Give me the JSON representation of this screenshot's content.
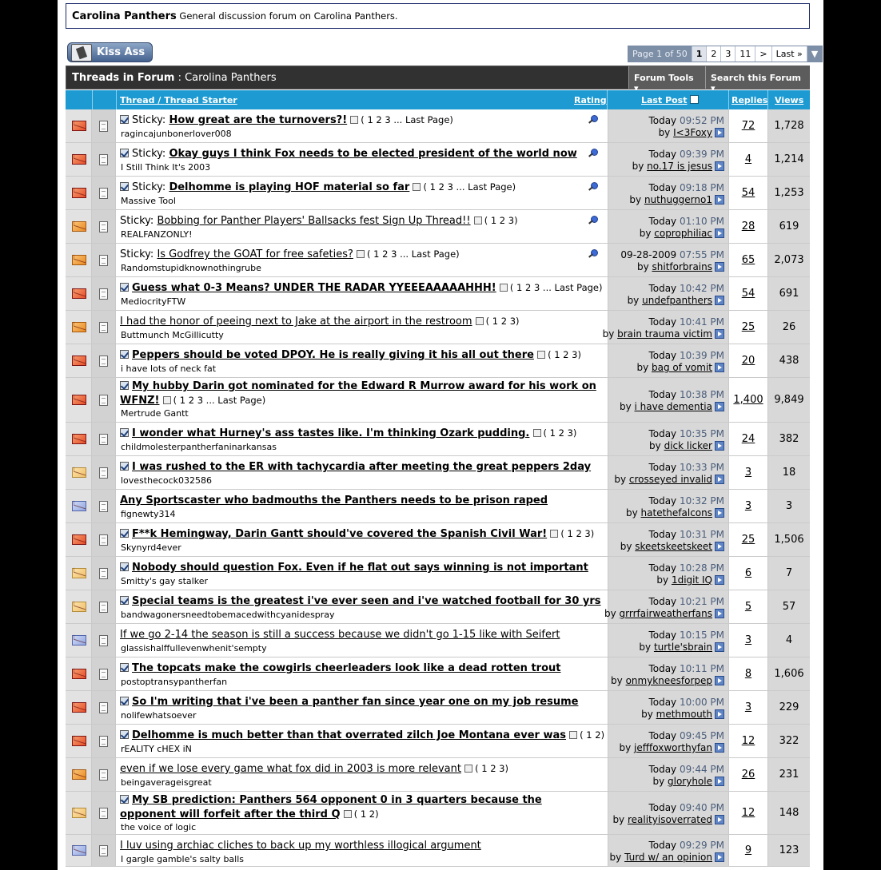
{
  "forum_header": {
    "name": "Carolina Panthers",
    "description": "General discussion forum on Carolina Panthers."
  },
  "kiss_button": "Kiss Ass",
  "pager": {
    "label": "Page 1 of 50",
    "current": "1",
    "pages": [
      "2",
      "3",
      "11"
    ],
    "next": ">",
    "last": "Last »",
    "dropdown": "▼"
  },
  "toolbar": {
    "title_prefix": "Threads in Forum",
    "title_sep": " : ",
    "forum_name": "Carolina Panthers",
    "forum_tools": "Forum Tools ▾",
    "search_forum": "Search this Forum ▾"
  },
  "columns": {
    "thread": "Thread",
    "slash": " / ",
    "thread_starter": "Thread Starter",
    "rating": "Rating",
    "last_post": "Last Post",
    "replies": "Replies",
    "views": "Views"
  },
  "colors": {
    "header_blue": "#1c9ad1",
    "toolbar_dark": "#313131",
    "cell_gray": "#d8d8d8"
  },
  "threads": [
    {
      "icon": "hot-new-folder",
      "sticky": true,
      "checked": true,
      "title": "How great are the turnovers?!",
      "bold": true,
      "pages": "( 1 2 3 ... Last Page)",
      "starter": "ragincajunbonerlover008",
      "pinned": true,
      "date": "Today",
      "time": "09:52 PM",
      "by": "I<3Foxy",
      "replies": "72",
      "views": "1,728"
    },
    {
      "icon": "hot-new-folder",
      "sticky": true,
      "checked": true,
      "title": "Okay guys I think Fox needs to be elected president of the world now",
      "bold": true,
      "pages": "",
      "starter": "I Still Think It's 2003",
      "pinned": true,
      "date": "Today",
      "time": "09:39 PM",
      "by": "no.17 is jesus",
      "replies": "4",
      "views": "1,214"
    },
    {
      "icon": "hot-new-folder",
      "sticky": true,
      "checked": true,
      "title": "Delhomme is playing HOF material so far",
      "bold": true,
      "pages": "( 1 2 3 ... Last Page)",
      "starter": "Massive Tool",
      "pinned": true,
      "date": "Today",
      "time": "09:18 PM",
      "by": "nuthuggerno1",
      "replies": "54",
      "views": "1,253"
    },
    {
      "icon": "hot-folder",
      "sticky": true,
      "checked": false,
      "title": "Bobbing for Panther Players' Ballsacks fest Sign Up Thread!!",
      "bold": false,
      "pages": "( 1 2 3)",
      "starter": "REALFANZONLY!",
      "pinned": true,
      "date": "Today",
      "time": "01:10 PM",
      "by": "coprophiliac",
      "replies": "28",
      "views": "619"
    },
    {
      "icon": "hot-folder",
      "sticky": true,
      "checked": false,
      "title": "Is Godfrey the GOAT for free safeties?",
      "bold": false,
      "pages": "( 1 2 3 ... Last Page)",
      "starter": "Randomstupidknownothingrube",
      "pinned": true,
      "date": "09-28-2009",
      "time": "07:55 PM",
      "by": "shitforbrains",
      "replies": "65",
      "views": "2,073"
    },
    {
      "icon": "hot-new-folder-posted",
      "sticky": false,
      "checked": true,
      "title": "Guess what 0-3 Means? UNDER THE RADAR YYEEEAAAAAHHH!",
      "bold": true,
      "pages": "( 1 2 3 ... Last Page)",
      "starter": "MediocrityFTW",
      "pinned": false,
      "date": "Today",
      "time": "10:42 PM",
      "by": "undefpanthers",
      "replies": "54",
      "views": "691"
    },
    {
      "icon": "hot-folder-posted",
      "sticky": false,
      "checked": false,
      "title": "I had the honor of peeing next to Jake at the airport in the restroom",
      "bold": false,
      "pages": "( 1 2 3)",
      "starter": "Buttmunch McGillicutty",
      "pinned": false,
      "date": "Today",
      "time": "10:41 PM",
      "by": "brain trauma victim",
      "replies": "25",
      "views": "26"
    },
    {
      "icon": "hot-new-folder",
      "sticky": false,
      "checked": true,
      "title": "Peppers should be voted DPOY. He is really giving it his all out there",
      "bold": true,
      "pages": "( 1 2 3)",
      "starter": "i have lots of neck fat",
      "pinned": false,
      "date": "Today",
      "time": "10:39 PM",
      "by": "bag of vomit",
      "replies": "20",
      "views": "438"
    },
    {
      "icon": "hot-new-folder-posted",
      "sticky": false,
      "checked": true,
      "title": "My hubby Darin got nominated for the Edward R Murrow award for his work on",
      "title2": "WFNZ!",
      "bold": true,
      "pages": "( 1 2 3 ... Last Page)",
      "starter": "Mertrude Gantt",
      "pinned": false,
      "date": "Today",
      "time": "10:38 PM",
      "by": "i have dementia",
      "replies": "1,400",
      "views": "9,849"
    },
    {
      "icon": "hot-new-folder",
      "sticky": false,
      "checked": true,
      "title": "I wonder what Hurney's ass tastes like. I'm thinking Ozark pudding.",
      "bold": true,
      "pages": "( 1 2 3)",
      "starter": "childmolesterpantherfaninarkansas",
      "pinned": false,
      "date": "Today",
      "time": "10:35 PM",
      "by": "dick licker",
      "replies": "24",
      "views": "382"
    },
    {
      "icon": "new-folder",
      "sticky": false,
      "checked": true,
      "title": "I was rushed to the ER with tachycardia after meeting the great peppers 2day",
      "bold": true,
      "pages": "",
      "starter": "lovesthecock032586",
      "pinned": false,
      "date": "Today",
      "time": "10:33 PM",
      "by": "crosseyed invalid",
      "replies": "3",
      "views": "18"
    },
    {
      "icon": "folder",
      "sticky": false,
      "checked": false,
      "title": "Any Sportscaster who badmouths the Panthers needs to be prison raped",
      "bold": true,
      "pages": "",
      "starter": "fignewty314",
      "pinned": false,
      "date": "Today",
      "time": "10:32 PM",
      "by": "hatethefalcons",
      "replies": "3",
      "views": "3"
    },
    {
      "icon": "hot-new-folder-posted",
      "sticky": false,
      "checked": true,
      "title": "F**k Hemingway, Darin Gantt should've covered the Spanish Civil War!",
      "bold": true,
      "pages": "( 1 2 3)",
      "starter": "Skynyrd4ever",
      "pinned": false,
      "date": "Today",
      "time": "10:31 PM",
      "by": "skeetskeetskeet",
      "replies": "25",
      "views": "1,506"
    },
    {
      "icon": "new-folder",
      "sticky": false,
      "checked": true,
      "title": "Nobody should question Fox. Even if he flat out says winning is not important",
      "bold": true,
      "pages": "",
      "starter": "Smitty's gay stalker",
      "pinned": false,
      "date": "Today",
      "time": "10:28 PM",
      "by": "1digit IQ",
      "replies": "6",
      "views": "7"
    },
    {
      "icon": "new-folder",
      "sticky": false,
      "checked": true,
      "title": "Special teams is the greatest i've ever seen and i've watched football for 30 yrs",
      "bold": true,
      "pages": "",
      "starter": "bandwagonersneedtobemacedwithcyanidespray",
      "pinned": false,
      "date": "Today",
      "time": "10:21 PM",
      "by": "grrrfairweatherfans",
      "replies": "5",
      "views": "57"
    },
    {
      "icon": "folder",
      "sticky": false,
      "checked": false,
      "title": "If we go 2-14 the season is still a success because we didn't go 1-15 like with Seifert",
      "bold": false,
      "pages": "",
      "starter": "glassishalffullevenwhenit'sempty",
      "pinned": false,
      "date": "Today",
      "time": "10:15 PM",
      "by": "turtle'sbrain",
      "replies": "3",
      "views": "4"
    },
    {
      "icon": "hot-new-folder",
      "sticky": false,
      "checked": true,
      "title": "The topcats make the cowgirls cheerleaders look like a dead rotten trout",
      "bold": true,
      "pages": "",
      "starter": "postoptransypantherfan",
      "pinned": false,
      "date": "Today",
      "time": "10:11 PM",
      "by": "onmykneesforpep",
      "replies": "8",
      "views": "1,606"
    },
    {
      "icon": "hot-new-folder",
      "sticky": false,
      "checked": true,
      "title": "So I'm writing that i've been a panther fan since year one on my job resume",
      "bold": true,
      "pages": "",
      "starter": "nolifewhatsoever",
      "pinned": false,
      "date": "Today",
      "time": "10:00 PM",
      "by": "methmouth",
      "replies": "3",
      "views": "229"
    },
    {
      "icon": "hot-new-folder-posted",
      "sticky": false,
      "checked": true,
      "title": "Delhomme is much better than that overrated zilch Joe Montana ever was",
      "bold": true,
      "pages": "( 1 2)",
      "starter": "rEALITY cHEX iN",
      "pinned": false,
      "date": "Today",
      "time": "09:45 PM",
      "by": "jefffoxworthyfan",
      "replies": "12",
      "views": "322"
    },
    {
      "icon": "hot-folder-posted",
      "sticky": false,
      "checked": false,
      "title": "even if we lose every game what fox did in 2003 is more relevant",
      "bold": false,
      "pages": "( 1 2 3)",
      "starter": "beingaverageisgreat",
      "pinned": false,
      "date": "Today",
      "time": "09:44 PM",
      "by": "gloryhole",
      "replies": "26",
      "views": "231"
    },
    {
      "icon": "new-folder",
      "sticky": false,
      "checked": true,
      "title": "My SB prediction: Panthers 564 opponent 0 in 3 quarters because the",
      "title2": "opponent will forfeit after the third Q",
      "bold": true,
      "pages": "( 1 2)",
      "starter": "the voice of logic",
      "pinned": false,
      "date": "Today",
      "time": "09:40 PM",
      "by": "realityisoverrated",
      "replies": "12",
      "views": "148"
    },
    {
      "icon": "folder-posted",
      "sticky": false,
      "checked": false,
      "title": "I luv using archiac cliches to back up my worthless illogical argument",
      "bold": false,
      "pages": "",
      "starter": "I gargle gamble's salty balls",
      "pinned": false,
      "date": "Today",
      "time": "09:29 PM",
      "by": "Turd w/ an opinion",
      "replies": "9",
      "views": "123"
    }
  ]
}
